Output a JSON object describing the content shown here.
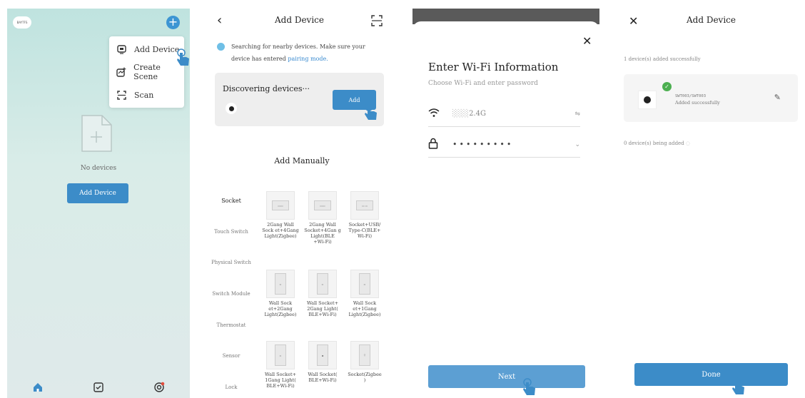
{
  "screen1": {
    "brand_logo_text": "BAYTFS",
    "menu": [
      {
        "label": "Add Device",
        "icon": "add-device-icon"
      },
      {
        "label": "Create Scene",
        "icon": "create-scene-icon"
      },
      {
        "label": "Scan",
        "icon": "scan-icon"
      }
    ],
    "empty_text": "No devices",
    "add_button": "Add Device",
    "tabs": [
      "home-icon",
      "checkbox-icon",
      "profile-icon"
    ]
  },
  "screen2": {
    "title": "Add Device",
    "search_text": "Searching for nearby devices. Make sure your device has entered ",
    "search_link": "pairing mode.",
    "discovering": "Discovering devices···",
    "add_button": "Add",
    "manual_title": "Add Manually",
    "categories": [
      "Socket",
      "Touch Switch",
      "Physical Switch",
      "Switch Module",
      "Thermostat",
      "Sensor",
      "Lock"
    ],
    "products_row1": [
      "2Gang Wall Sock et+4Gang Light(Zigbee)",
      "2Gang Wall Socket+4Gan g Light(BLE +Wi-Fi)",
      "Socket+USB/ Type-C(BLE+ Wi-Fi)"
    ],
    "products_row2": [
      "Wall Sock et+2Gang Light(Zigbee)",
      "Wall Socket+ 2Gang Light( BLE+Wi-Fi)",
      "Wall Sock et+1Gang Light(Zigbee)"
    ],
    "products_row3": [
      "Wall Socket+ 1Gang Light( BLE+Wi-Fi)",
      "Wall Socket( BLE+Wi-Fi)",
      "Socket(Zigbee )"
    ]
  },
  "screen3": {
    "title": "Enter Wi-Fi Information",
    "subtitle": "Choose Wi-Fi and enter password",
    "wifi_value": "2.4G",
    "password_mask": "•••••••••",
    "next_button": "Next"
  },
  "screen4": {
    "title": "Add Device",
    "success_text": "1 device(s) added successfully",
    "device_name": "SWT003/SWT003",
    "device_status": "Added successfully",
    "adding_text": "0 device(s) being added",
    "done_button": "Done"
  },
  "colors": {
    "primary": "#3c8cc8",
    "accent": "#3c95d3",
    "success": "#4caf50"
  }
}
